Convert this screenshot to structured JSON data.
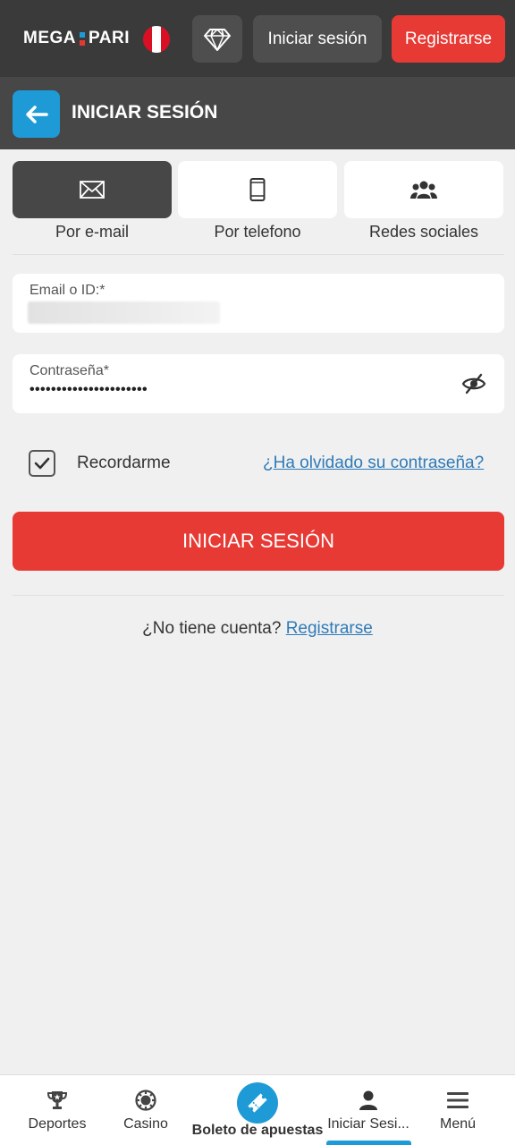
{
  "header": {
    "logo_left": "MEGA",
    "logo_right": "PARI",
    "login_label": "Iniciar sesión",
    "register_label": "Registrarse"
  },
  "titlebar": {
    "title": "INICIAR SESIÓN"
  },
  "tabs": [
    {
      "label": "Por e-mail",
      "icon": "envelope-icon",
      "active": true
    },
    {
      "label": "Por telefono",
      "icon": "phone-icon",
      "active": false
    },
    {
      "label": "Redes sociales",
      "icon": "people-icon",
      "active": false
    }
  ],
  "form": {
    "email_label": "Email o ID:*",
    "password_label": "Contraseña*",
    "password_value": "••••••••••••••••••••••",
    "remember_label": "Recordarme",
    "remember_checked": true,
    "forgot_label": "¿Ha olvidado su contraseña?",
    "submit_label": "INICIAR SESIÓN"
  },
  "signup": {
    "prompt": "¿No tiene cuenta?",
    "link": "Registrarse"
  },
  "bottom_nav": [
    {
      "label": "Deportes",
      "icon": "trophy-icon"
    },
    {
      "label": "Casino",
      "icon": "casino-chip-icon"
    },
    {
      "label": "Boleto de apuestas",
      "icon": "ticket-icon"
    },
    {
      "label": "Iniciar Sesi...",
      "icon": "user-icon",
      "active": true
    },
    {
      "label": "Menú",
      "icon": "menu-icon"
    }
  ],
  "colors": {
    "brand_red": "#e73a34",
    "brand_blue": "#1e9bd7",
    "header_dark": "#3a3a3a",
    "link_blue": "#2f7bb8"
  }
}
